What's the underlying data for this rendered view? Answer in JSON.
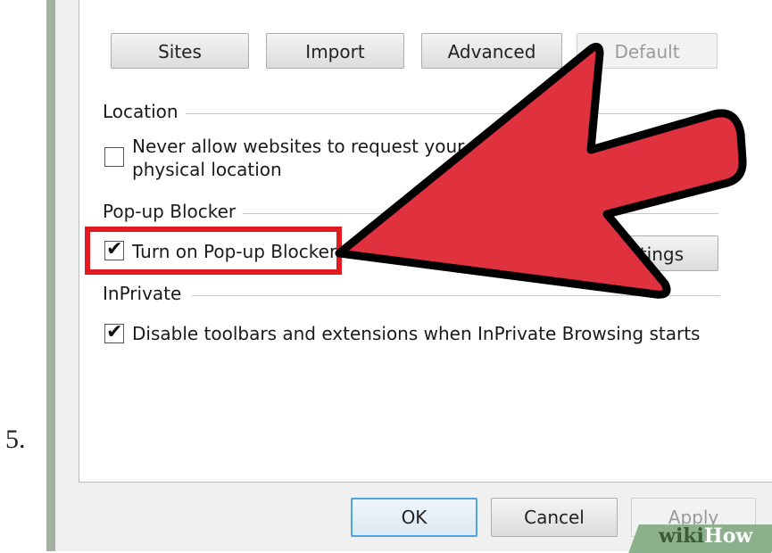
{
  "step_number": "5.",
  "top_buttons": {
    "sites": "Sites",
    "import": "Import",
    "advanced": "Advanced",
    "default": "Default"
  },
  "location": {
    "group_label": "Location",
    "checkbox_label_line1": "Never allow websites to request your",
    "checkbox_label_line2": "physical location",
    "checked": false
  },
  "popup_blocker": {
    "group_label": "Pop-up Blocker",
    "checkbox_label": "Turn on Pop-up Blocker",
    "checked": true,
    "settings_button_visible": "ttings"
  },
  "inprivate": {
    "group_label": "InPrivate",
    "checkbox_label": "Disable toolbars and extensions when InPrivate Browsing starts",
    "checked": true
  },
  "dialog_buttons": {
    "ok": "OK",
    "cancel": "Cancel",
    "apply": "Apply"
  },
  "watermark": {
    "wiki": "wiki",
    "how": "How"
  },
  "colors": {
    "highlight": "#e21b23",
    "arrow_fill": "#e0313f",
    "arrow_stroke": "#000000"
  }
}
